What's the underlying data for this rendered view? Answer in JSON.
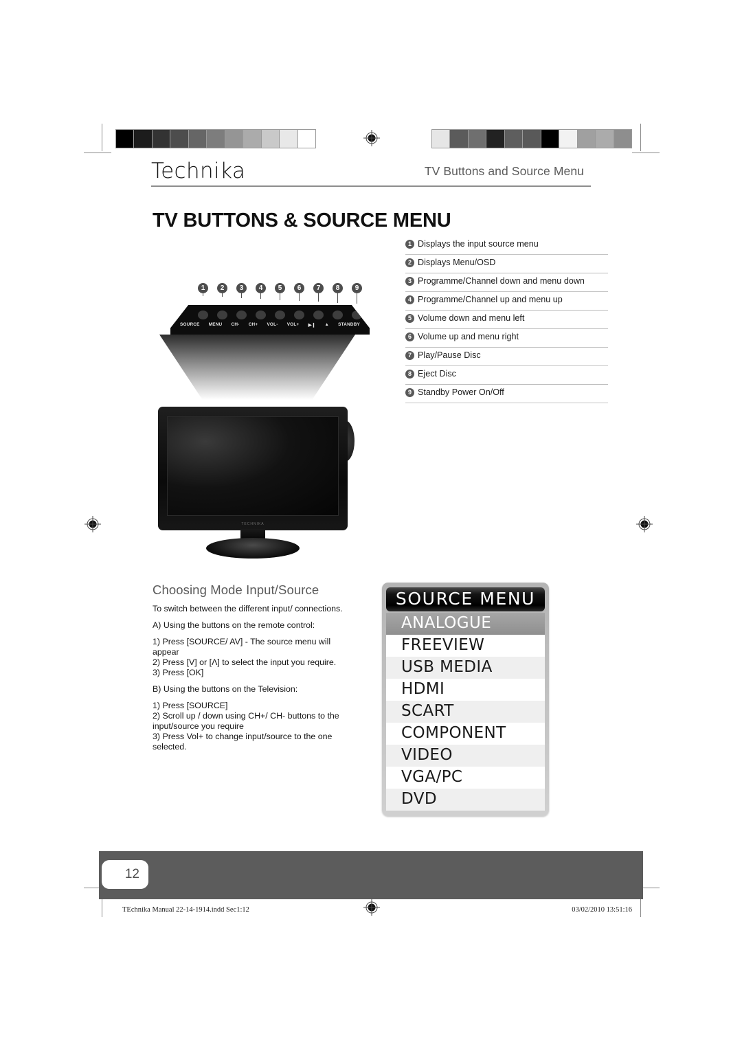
{
  "header": {
    "brand": "Technika",
    "running_head": "TV Buttons and Source Menu",
    "page_title": "TV BUTTONS & SOURCE MENU"
  },
  "legend": {
    "items": [
      {
        "num": "1",
        "text": "Displays the input source menu"
      },
      {
        "num": "2",
        "text": "Displays Menu/OSD"
      },
      {
        "num": "3",
        "text": "Programme/Channel down and menu down"
      },
      {
        "num": "4",
        "text": "Programme/Channel up and menu up"
      },
      {
        "num": "5",
        "text": "Volume down and menu left"
      },
      {
        "num": "6",
        "text": "Volume up and menu right"
      },
      {
        "num": "7",
        "text": "Play/Pause Disc"
      },
      {
        "num": "8",
        "text": "Eject Disc"
      },
      {
        "num": "9",
        "text": "Standby Power On/Off"
      }
    ]
  },
  "button_panel": {
    "numbers": [
      "1",
      "2",
      "3",
      "4",
      "5",
      "6",
      "7",
      "8",
      "9"
    ],
    "labels": [
      "SOURCE",
      "MENU",
      "CH-",
      "CH+",
      "VOL-",
      "VOL+",
      "▶❙",
      "▲",
      "STANDBY"
    ]
  },
  "tv_illustration": {
    "brand_mark": "TECHNIKA"
  },
  "instructions": {
    "heading": "Choosing Mode Input/Source",
    "intro": "To switch between the different input/ connections.",
    "section_a": "A) Using the buttons on the remote control:",
    "a_steps": "1) Press [SOURCE/ AV] - The source menu will appear\n2) Press [V] or [Λ] to select the input you require.\n3) Press [OK]",
    "section_b": "B) Using the buttons on the Television:",
    "b_steps": "1) Press [SOURCE]\n2) Scroll up / down using CH+/ CH- buttons to the input/source you require\n3) Press Vol+ to change input/source to the one selected."
  },
  "source_menu": {
    "title": "SOURCE MENU",
    "selected": "ANALOGUE",
    "items": [
      {
        "label": "ANALOGUE",
        "selected": true
      },
      {
        "label": "FREEVIEW",
        "selected": false
      },
      {
        "label": "USB MEDIA",
        "selected": false
      },
      {
        "label": "HDMI",
        "selected": false
      },
      {
        "label": "SCART",
        "selected": false
      },
      {
        "label": "COMPONENT",
        "selected": false
      },
      {
        "label": "VIDEO",
        "selected": false
      },
      {
        "label": "VGA/PC",
        "selected": false
      },
      {
        "label": "DVD",
        "selected": false
      }
    ]
  },
  "footer": {
    "page_number": "12",
    "file_info": "TEchnika Manual 22-14-1914.indd   Sec1:12",
    "timestamp": "03/02/2010   13:51:16"
  },
  "calibration": {
    "left_strip": [
      "#000000",
      "#1c1c1c",
      "#333333",
      "#4d4d4d",
      "#666666",
      "#7d7d7d",
      "#959595",
      "#ababab",
      "#c9c9c9",
      "#e8e8e8",
      "#ffffff"
    ],
    "right_strip": [
      "#e6e6e6",
      "#5b5b5b",
      "#6f6f6f",
      "#222222",
      "#5e5e5e",
      "#595959",
      "#000000",
      "#f2f2f2",
      "#a0a0a0",
      "#ababab",
      "#8e8e8e"
    ]
  }
}
